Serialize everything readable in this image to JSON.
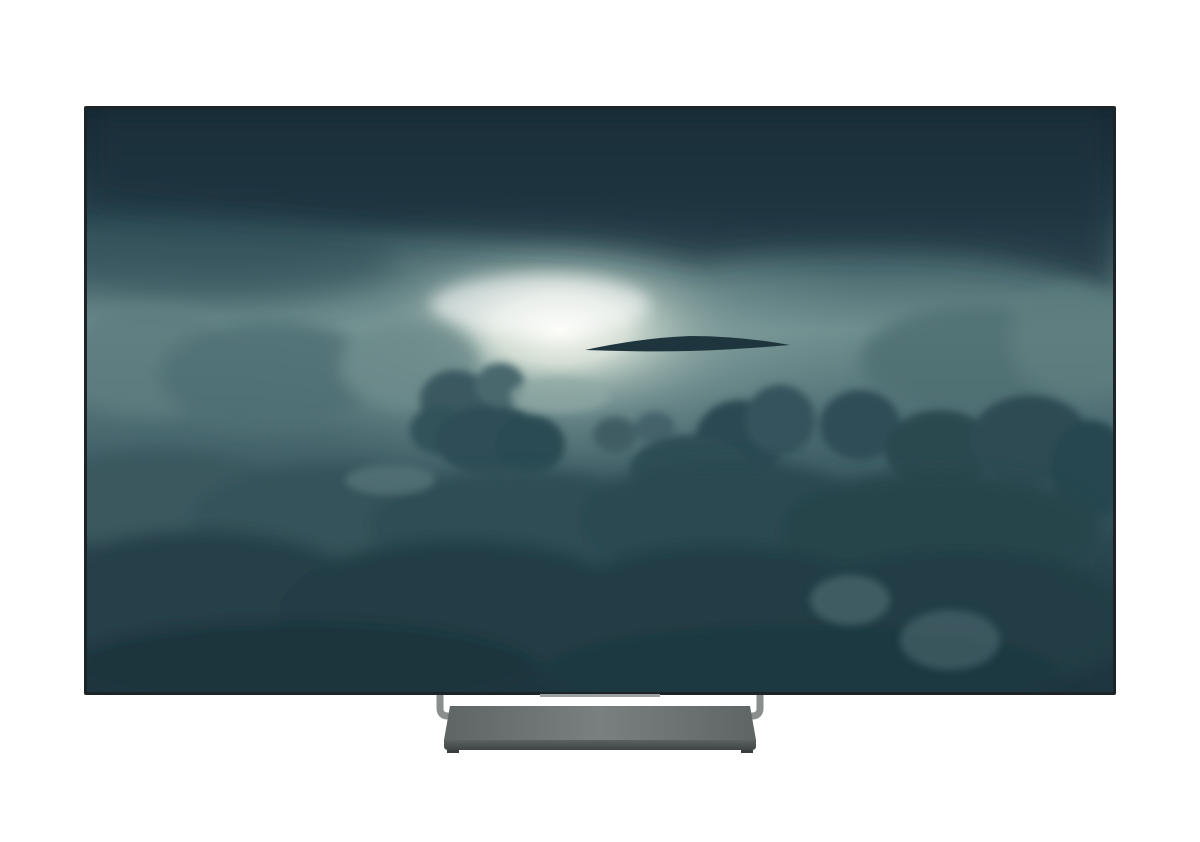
{
  "scene": {
    "subject": "television",
    "screen_content": "storm-clouds",
    "background_color": "#ffffff"
  },
  "colors": {
    "bezel": "#1c2428",
    "sky_top": "#1e3540",
    "sky_mid": "#4d7178",
    "glow": "#f4f7ef",
    "cloud_dark": "#1f3a43",
    "cloud_mid": "#3d5c63",
    "cloud_light": "#7f9c9c",
    "stand_top": "#6e7473",
    "stand_front": "#4d5352",
    "neck": "#8a8f8e"
  }
}
